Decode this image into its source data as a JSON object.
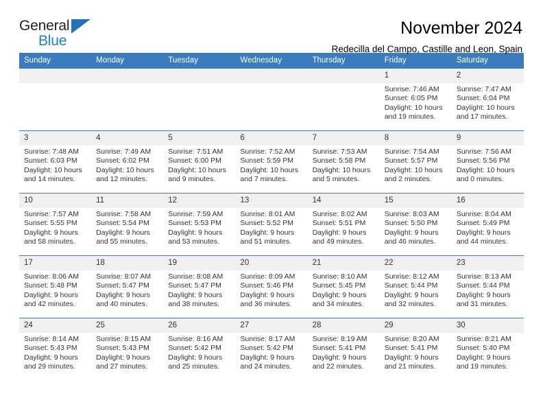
{
  "logo": {
    "word_one": "General",
    "word_two": "Blue",
    "triangle_icon": "triangle-icon"
  },
  "header": {
    "title": "November 2024",
    "subtitle": "Redecilla del Campo, Castille and Leon, Spain"
  },
  "colors": {
    "header_blue": "#3a7cbe",
    "logo_blue": "#1b7fd4",
    "daynum_bg": "#f0f0f0",
    "text": "#333333"
  },
  "calendar": {
    "weekday_headers": [
      "Sunday",
      "Monday",
      "Tuesday",
      "Wednesday",
      "Thursday",
      "Friday",
      "Saturday"
    ],
    "weeks": [
      [
        {
          "day": "",
          "sunrise": "",
          "sunset": "",
          "daylight": ""
        },
        {
          "day": "",
          "sunrise": "",
          "sunset": "",
          "daylight": ""
        },
        {
          "day": "",
          "sunrise": "",
          "sunset": "",
          "daylight": ""
        },
        {
          "day": "",
          "sunrise": "",
          "sunset": "",
          "daylight": ""
        },
        {
          "day": "",
          "sunrise": "",
          "sunset": "",
          "daylight": ""
        },
        {
          "day": "1",
          "sunrise": "Sunrise: 7:46 AM",
          "sunset": "Sunset: 6:05 PM",
          "daylight": "Daylight: 10 hours and 19 minutes."
        },
        {
          "day": "2",
          "sunrise": "Sunrise: 7:47 AM",
          "sunset": "Sunset: 6:04 PM",
          "daylight": "Daylight: 10 hours and 17 minutes."
        }
      ],
      [
        {
          "day": "3",
          "sunrise": "Sunrise: 7:48 AM",
          "sunset": "Sunset: 6:03 PM",
          "daylight": "Daylight: 10 hours and 14 minutes."
        },
        {
          "day": "4",
          "sunrise": "Sunrise: 7:49 AM",
          "sunset": "Sunset: 6:02 PM",
          "daylight": "Daylight: 10 hours and 12 minutes."
        },
        {
          "day": "5",
          "sunrise": "Sunrise: 7:51 AM",
          "sunset": "Sunset: 6:00 PM",
          "daylight": "Daylight: 10 hours and 9 minutes."
        },
        {
          "day": "6",
          "sunrise": "Sunrise: 7:52 AM",
          "sunset": "Sunset: 5:59 PM",
          "daylight": "Daylight: 10 hours and 7 minutes."
        },
        {
          "day": "7",
          "sunrise": "Sunrise: 7:53 AM",
          "sunset": "Sunset: 5:58 PM",
          "daylight": "Daylight: 10 hours and 5 minutes."
        },
        {
          "day": "8",
          "sunrise": "Sunrise: 7:54 AM",
          "sunset": "Sunset: 5:57 PM",
          "daylight": "Daylight: 10 hours and 2 minutes."
        },
        {
          "day": "9",
          "sunrise": "Sunrise: 7:56 AM",
          "sunset": "Sunset: 5:56 PM",
          "daylight": "Daylight: 10 hours and 0 minutes."
        }
      ],
      [
        {
          "day": "10",
          "sunrise": "Sunrise: 7:57 AM",
          "sunset": "Sunset: 5:55 PM",
          "daylight": "Daylight: 9 hours and 58 minutes."
        },
        {
          "day": "11",
          "sunrise": "Sunrise: 7:58 AM",
          "sunset": "Sunset: 5:54 PM",
          "daylight": "Daylight: 9 hours and 55 minutes."
        },
        {
          "day": "12",
          "sunrise": "Sunrise: 7:59 AM",
          "sunset": "Sunset: 5:53 PM",
          "daylight": "Daylight: 9 hours and 53 minutes."
        },
        {
          "day": "13",
          "sunrise": "Sunrise: 8:01 AM",
          "sunset": "Sunset: 5:52 PM",
          "daylight": "Daylight: 9 hours and 51 minutes."
        },
        {
          "day": "14",
          "sunrise": "Sunrise: 8:02 AM",
          "sunset": "Sunset: 5:51 PM",
          "daylight": "Daylight: 9 hours and 49 minutes."
        },
        {
          "day": "15",
          "sunrise": "Sunrise: 8:03 AM",
          "sunset": "Sunset: 5:50 PM",
          "daylight": "Daylight: 9 hours and 46 minutes."
        },
        {
          "day": "16",
          "sunrise": "Sunrise: 8:04 AM",
          "sunset": "Sunset: 5:49 PM",
          "daylight": "Daylight: 9 hours and 44 minutes."
        }
      ],
      [
        {
          "day": "17",
          "sunrise": "Sunrise: 8:06 AM",
          "sunset": "Sunset: 5:48 PM",
          "daylight": "Daylight: 9 hours and 42 minutes."
        },
        {
          "day": "18",
          "sunrise": "Sunrise: 8:07 AM",
          "sunset": "Sunset: 5:47 PM",
          "daylight": "Daylight: 9 hours and 40 minutes."
        },
        {
          "day": "19",
          "sunrise": "Sunrise: 8:08 AM",
          "sunset": "Sunset: 5:47 PM",
          "daylight": "Daylight: 9 hours and 38 minutes."
        },
        {
          "day": "20",
          "sunrise": "Sunrise: 8:09 AM",
          "sunset": "Sunset: 5:46 PM",
          "daylight": "Daylight: 9 hours and 36 minutes."
        },
        {
          "day": "21",
          "sunrise": "Sunrise: 8:10 AM",
          "sunset": "Sunset: 5:45 PM",
          "daylight": "Daylight: 9 hours and 34 minutes."
        },
        {
          "day": "22",
          "sunrise": "Sunrise: 8:12 AM",
          "sunset": "Sunset: 5:44 PM",
          "daylight": "Daylight: 9 hours and 32 minutes."
        },
        {
          "day": "23",
          "sunrise": "Sunrise: 8:13 AM",
          "sunset": "Sunset: 5:44 PM",
          "daylight": "Daylight: 9 hours and 31 minutes."
        }
      ],
      [
        {
          "day": "24",
          "sunrise": "Sunrise: 8:14 AM",
          "sunset": "Sunset: 5:43 PM",
          "daylight": "Daylight: 9 hours and 29 minutes."
        },
        {
          "day": "25",
          "sunrise": "Sunrise: 8:15 AM",
          "sunset": "Sunset: 5:43 PM",
          "daylight": "Daylight: 9 hours and 27 minutes."
        },
        {
          "day": "26",
          "sunrise": "Sunrise: 8:16 AM",
          "sunset": "Sunset: 5:42 PM",
          "daylight": "Daylight: 9 hours and 25 minutes."
        },
        {
          "day": "27",
          "sunrise": "Sunrise: 8:17 AM",
          "sunset": "Sunset: 5:42 PM",
          "daylight": "Daylight: 9 hours and 24 minutes."
        },
        {
          "day": "28",
          "sunrise": "Sunrise: 8:19 AM",
          "sunset": "Sunset: 5:41 PM",
          "daylight": "Daylight: 9 hours and 22 minutes."
        },
        {
          "day": "29",
          "sunrise": "Sunrise: 8:20 AM",
          "sunset": "Sunset: 5:41 PM",
          "daylight": "Daylight: 9 hours and 21 minutes."
        },
        {
          "day": "30",
          "sunrise": "Sunrise: 8:21 AM",
          "sunset": "Sunset: 5:40 PM",
          "daylight": "Daylight: 9 hours and 19 minutes."
        }
      ]
    ]
  }
}
